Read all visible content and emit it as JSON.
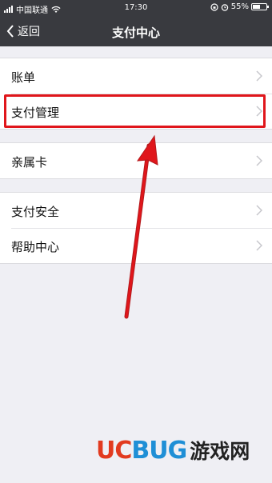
{
  "status_bar": {
    "carrier": "中国联通",
    "time": "17:30",
    "battery_percent": "55%",
    "battery_level": 0.55,
    "icons": [
      "signal-icon",
      "wifi-icon",
      "lock-rotation-icon",
      "alarm-icon",
      "battery-icon"
    ]
  },
  "nav": {
    "back_label": "返回",
    "title": "支付中心"
  },
  "group1": {
    "items": [
      {
        "label": "账单"
      },
      {
        "label": "支付管理"
      }
    ]
  },
  "group2": {
    "items": [
      {
        "label": "亲属卡"
      }
    ]
  },
  "group3": {
    "items": [
      {
        "label": "支付安全"
      },
      {
        "label": "帮助中心"
      }
    ]
  },
  "annotation": {
    "color": "#e0161b",
    "highlighted_item": "支付管理"
  },
  "watermark": {
    "uc": "UC",
    "bug": "BUG",
    "site": "游戏网"
  },
  "colors": {
    "nav_bg": "#393a3f",
    "page_bg": "#efeff4",
    "accent_red": "#e0161b"
  }
}
